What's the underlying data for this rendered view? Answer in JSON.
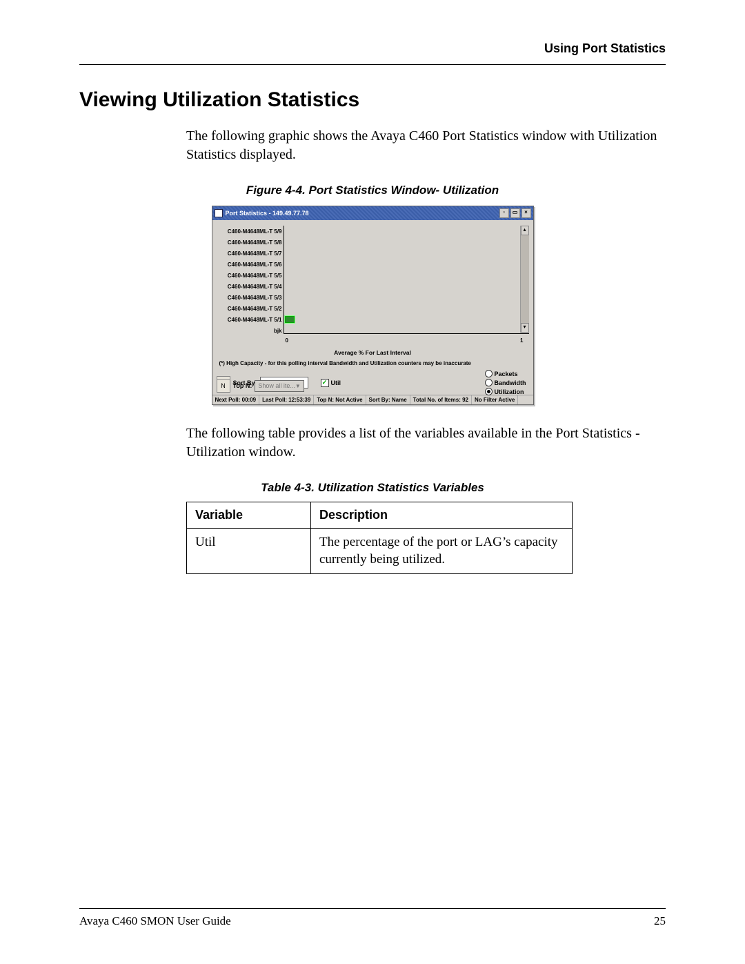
{
  "header": {
    "running_head": "Using Port Statistics"
  },
  "section": {
    "title": "Viewing Utilization Statistics"
  },
  "para1": "The following graphic shows the Avaya C460 Port Statistics window with Utilization Statistics displayed.",
  "figure": {
    "caption": "Figure 4-4.  Port Statistics Window- Utilization"
  },
  "app": {
    "title": "Port Statistics - 149.49.77.78",
    "y_labels": [
      "C460-M4648ML-T 5/9",
      "C460-M4648ML-T 5/8",
      "C460-M4648ML-T 5/7",
      "C460-M4648ML-T 5/6",
      "C460-M4648ML-T 5/5",
      "C460-M4648ML-T 5/4",
      "C460-M4648ML-T 5/3",
      "C460-M4648ML-T 5/2",
      "C460-M4648ML-T 5/1",
      "bjk"
    ],
    "x_min": "0",
    "x_max": "1",
    "x_title": "Average % For Last Interval",
    "hc_note": "(*) High Capacity - for this polling interval Bandwidth and Utilization counters may be inaccurate",
    "sort_by_label": "Sort By:",
    "sort_by_value": "Name",
    "top_n_label": "Top N:",
    "top_n_value": "Show all ite...",
    "chk_util": "Util",
    "radio": {
      "packets": "Packets",
      "bandwidth": "Bandwidth",
      "utilization": "Utilization"
    },
    "status": {
      "next_poll": "Next Poll: 00:09",
      "last_poll": "Last Poll: 12:53:39",
      "top_n": "Top N: Not Active",
      "sort_by": "Sort By: Name",
      "total": "Total No. of Items: 92",
      "filter": "No Filter Active"
    }
  },
  "para2": "The following table provides a list of the variables available in the Port Statistics - Utilization window.",
  "table": {
    "caption": "Table 4-3.  Utilization Statistics Variables",
    "head_variable": "Variable",
    "head_description": "Description",
    "rows": [
      {
        "variable": "Util",
        "description": "The percentage of the port or LAG’s capacity currently being utilized."
      }
    ]
  },
  "footer": {
    "guide": "Avaya C460 SMON User Guide",
    "page": "25"
  },
  "chart_data": {
    "type": "bar",
    "orientation": "horizontal",
    "title": "Average % For Last Interval",
    "xlabel": "Average % For Last Interval",
    "ylabel": "",
    "xlim": [
      0,
      1
    ],
    "categories": [
      "C460-M4648ML-T 5/9",
      "C460-M4648ML-T 5/8",
      "C460-M4648ML-T 5/7",
      "C460-M4648ML-T 5/6",
      "C460-M4648ML-T 5/5",
      "C460-M4648ML-T 5/4",
      "C460-M4648ML-T 5/3",
      "C460-M4648ML-T 5/2",
      "C460-M4648ML-T 5/1",
      "bjk"
    ],
    "series": [
      {
        "name": "Util",
        "values": [
          0,
          0,
          0,
          0,
          0,
          0,
          0,
          0,
          0.05,
          0
        ]
      }
    ]
  }
}
